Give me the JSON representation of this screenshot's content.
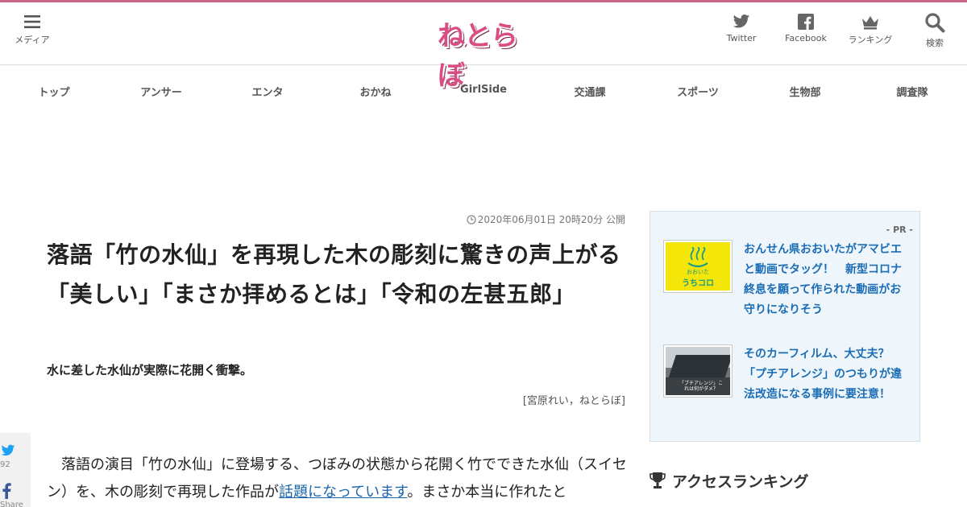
{
  "brand": {
    "logo_text": "ねとらぼ",
    "accent": "#c8678a",
    "logo_color": "#d94d82",
    "link_color": "#1a64ad"
  },
  "header": {
    "menu": {
      "label": "メディア",
      "icon": "hamburger-icon"
    },
    "twitter": {
      "label": "Twitter",
      "icon": "twitter-icon"
    },
    "facebook": {
      "label": "Facebook",
      "icon": "facebook-icon"
    },
    "ranking": {
      "label": "ランキング",
      "icon": "crown-icon"
    },
    "search": {
      "label": "検索",
      "icon": "search-icon"
    }
  },
  "nav": {
    "items": [
      {
        "label": "トップ"
      },
      {
        "label": "アンサー"
      },
      {
        "label": "エンタ"
      },
      {
        "label": "おかね"
      },
      {
        "label": "GirlSide"
      },
      {
        "label": "交通課"
      },
      {
        "label": "スポーツ"
      },
      {
        "label": "生物部"
      },
      {
        "label": "調査隊"
      }
    ]
  },
  "article": {
    "published": "2020年06月01日 20時20分 公開",
    "title": "落語「竹の水仙」を再現した木の彫刻に驚きの声上がる　「美しい」「まさか拝めるとは」「令和の左甚五郎」",
    "subtitle": "水に差した水仙が実際に花開く衝撃。",
    "byline": "[宮原れい，ねとらぼ]",
    "body_before_link": "　落語の演目「竹の水仙」に登場する、つぼみの状態から花開く竹でできた水仙（スイセン）を、木の彫刻で再現した作品が",
    "body_link": "話題になっています",
    "body_after_link": "。まさか本当に作れたと"
  },
  "share": {
    "twitter_count": "92",
    "facebook_label": "Share"
  },
  "pr": {
    "label": "- PR -",
    "items": [
      {
        "title": "おんせん県おおいたがアマビエと動画でタッグ！　新型コロナ終息を願って作られた動画がお守りになりそう",
        "thumb_text": "うちコロ",
        "thumb_small": "おおいた",
        "thumb_bg": "#f5e60a"
      },
      {
        "title": "そのカーフィルム、大丈夫？「プチアレンジ」のつもりが違法改造になる事例に要注意！",
        "thumb_text": "「プチアレンジ」これは何がダメ？"
      }
    ]
  },
  "ranking": {
    "heading": "アクセスランキング"
  }
}
